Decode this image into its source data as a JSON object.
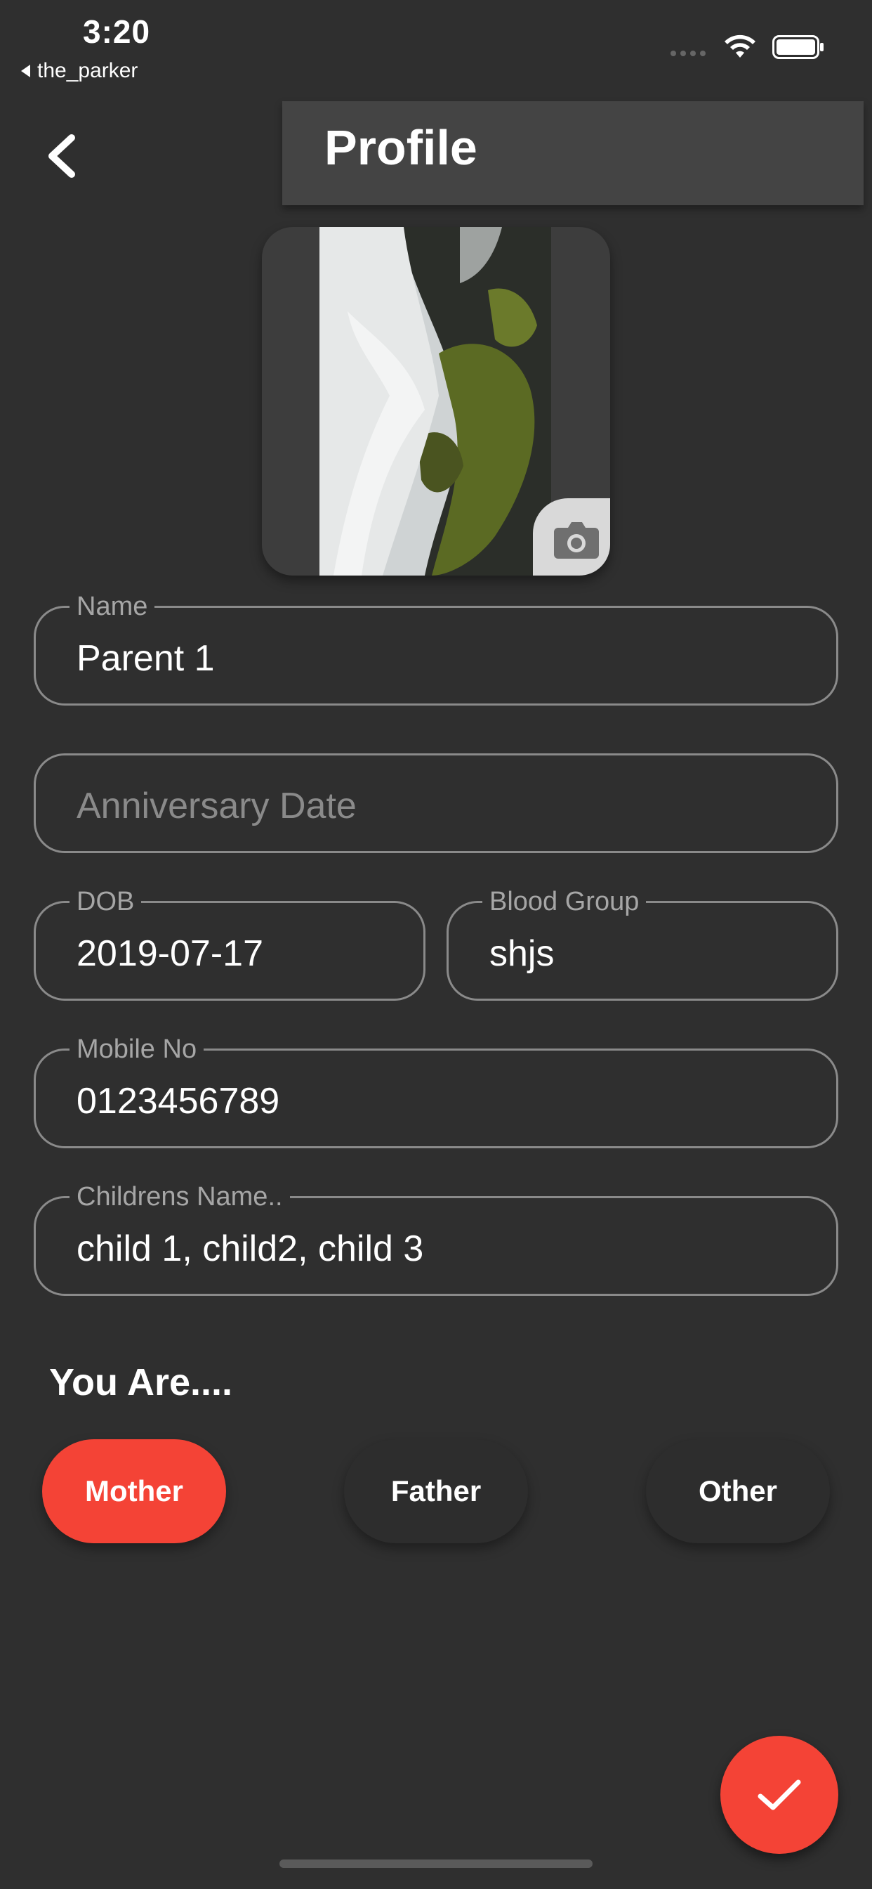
{
  "status_bar": {
    "time": "3:20",
    "back_app": "the_parker"
  },
  "header": {
    "title": "Profile"
  },
  "form": {
    "name": {
      "label": "Name",
      "value": "Parent 1"
    },
    "anniversary": {
      "placeholder": "Anniversary Date",
      "value": ""
    },
    "dob": {
      "label": "DOB",
      "value": "2019-07-17"
    },
    "blood_group": {
      "label": "Blood Group",
      "value": "shjs"
    },
    "mobile": {
      "label": "Mobile No",
      "value": "0123456789"
    },
    "children": {
      "label": "Childrens Name..",
      "value": "child 1, child2, child 3"
    }
  },
  "you_are": {
    "title": "You Are....",
    "options": [
      "Mother",
      "Father",
      "Other"
    ],
    "selected": "Mother"
  },
  "colors": {
    "background": "#2f2f2f",
    "accent": "#f44336",
    "title_bar": "#444444",
    "field_border": "#8a8a8a"
  },
  "icons": [
    "back-arrow-icon",
    "camera-icon",
    "check-icon",
    "wifi-icon",
    "battery-icon"
  ]
}
